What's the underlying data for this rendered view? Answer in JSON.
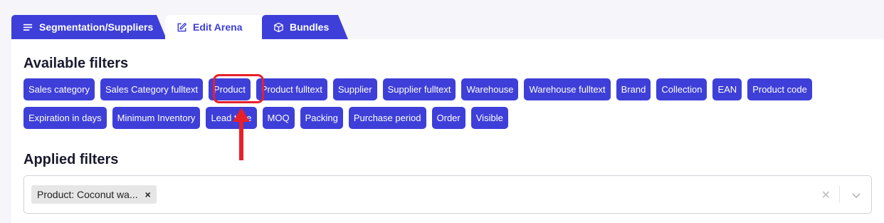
{
  "tabs": [
    {
      "label": "Segmentation/Suppliers",
      "icon": "list-icon"
    },
    {
      "label": "Edit Arena",
      "icon": "edit-icon"
    },
    {
      "label": "Bundles",
      "icon": "box-icon"
    }
  ],
  "available_filters": {
    "title": "Available filters",
    "row1": [
      "Sales category",
      "Sales Category fulltext",
      "Product",
      "Product fulltext",
      "Supplier",
      "Supplier fulltext",
      "Warehouse",
      "Warehouse fulltext",
      "Brand",
      "Collection",
      "EAN",
      "Product code"
    ],
    "row2": [
      "Expiration in days",
      "Minimum Inventory",
      "Lead time",
      "MOQ",
      "Packing",
      "Purchase period",
      "Order",
      "Visible"
    ]
  },
  "applied_filters": {
    "title": "Applied filters",
    "tags": [
      {
        "label": "Product: Coconut wa...",
        "remove": "×"
      }
    ],
    "clear_all": "✕"
  },
  "colors": {
    "accent": "#3e3fd8",
    "highlight": "#e8202a"
  }
}
